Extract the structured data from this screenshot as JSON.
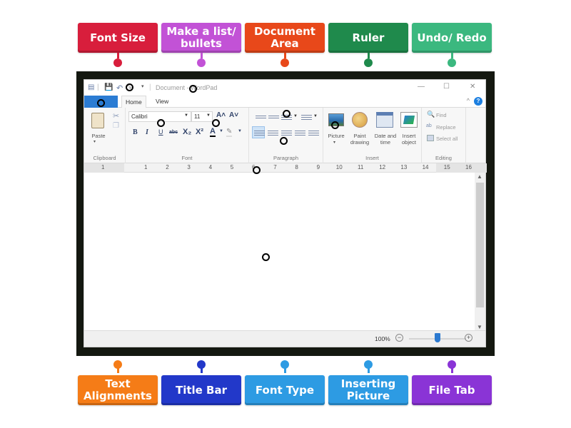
{
  "top_labels": [
    {
      "text": "Font Size",
      "color": "#d81e3c"
    },
    {
      "text": "Make a list/ bullets",
      "color": "#c252d6"
    },
    {
      "text": "Document Area",
      "color": "#e8481a"
    },
    {
      "text": "Ruler",
      "color": "#1f8a4c"
    },
    {
      "text": "Undo/ Redo",
      "color": "#3bb87f"
    }
  ],
  "bottom_labels": [
    {
      "text": "Text Alignments",
      "color": "#f57c17"
    },
    {
      "text": "Title Bar",
      "color": "#2238c9"
    },
    {
      "text": "Font Type",
      "color": "#2d9be3"
    },
    {
      "text": "Inserting Picture",
      "color": "#2d9be3"
    },
    {
      "text": "File Tab",
      "color": "#8a34d6"
    }
  ],
  "app": {
    "title": "Document - WordPad",
    "title_visible": "Document",
    "title_suffix": "ordPad",
    "quick_access": {
      "save_icon": "save-icon",
      "undo_icon": "undo-icon",
      "redo_icon": "redo-icon",
      "customize_icon": "chevron-down-icon"
    },
    "window_controls": {
      "minimize": "—",
      "maximize": "☐",
      "close": "✕"
    },
    "tabs": [
      {
        "label": "Home",
        "active": true
      },
      {
        "label": "View",
        "active": false
      }
    ],
    "help": "?",
    "collapse_ribbon": "^"
  },
  "ribbon": {
    "clipboard": {
      "name": "Clipboard",
      "paste": "Paste"
    },
    "font": {
      "name": "Font",
      "family": "Calibri",
      "size": "11",
      "bold": "B",
      "italic": "I",
      "underline": "U",
      "strike": "abc",
      "subscript": "X₂",
      "superscript": "X²",
      "color": "A",
      "grow": "A˄",
      "shrink": "A˅"
    },
    "paragraph": {
      "name": "Paragraph"
    },
    "insert": {
      "name": "Insert",
      "picture": "Picture",
      "paint": "Paint drawing",
      "datetime": "Date and time",
      "object": "Insert object"
    },
    "editing": {
      "name": "Editing",
      "find": "Find",
      "replace": "Replace",
      "select_all": "Select all"
    }
  },
  "ruler": {
    "left_numbers": [
      "1"
    ],
    "numbers": [
      "1",
      "2",
      "3",
      "4",
      "5",
      "6",
      "7",
      "8",
      "9",
      "10",
      "11",
      "12",
      "13",
      "14",
      "15",
      "16"
    ]
  },
  "status": {
    "zoom": "100%",
    "zoom_level_fraction": 0.5
  }
}
